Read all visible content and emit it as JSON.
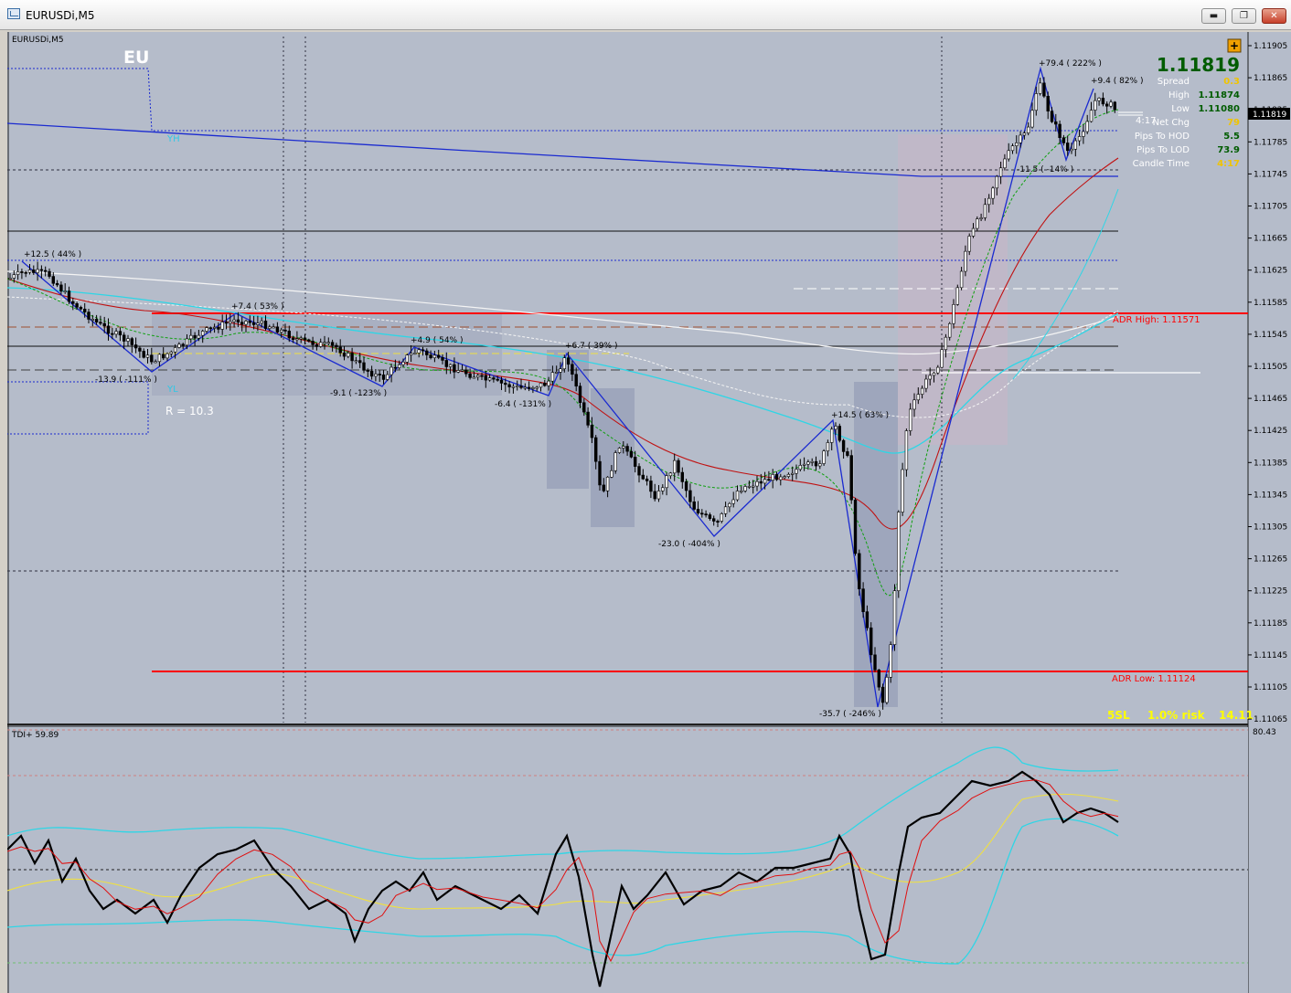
{
  "window": {
    "title": "EURUSDi,M5",
    "buttons": {
      "minimize": "▬",
      "maximize": "❐",
      "close": "✕"
    }
  },
  "chart": {
    "name": "EURUSDi,M5",
    "symbol_label": "EU",
    "yh_label": "YH",
    "yl_label": "YL",
    "range_label": "R = 10.3",
    "current_price": "1.11819",
    "price_tag": "1.11819",
    "countdown": "4:17",
    "price_axis": [
      "1.11905",
      "1.11865",
      "1.11825",
      "1.11785",
      "1.11745",
      "1.11705",
      "1.11665",
      "1.11625",
      "1.11585",
      "1.11545",
      "1.11505",
      "1.11465",
      "1.11425",
      "1.11385",
      "1.11345",
      "1.11305",
      "1.11265",
      "1.11225",
      "1.11185",
      "1.11145",
      "1.11105",
      "1.11065"
    ],
    "adr_high": "ADR High: 1.11571",
    "adr_low": "ADR Low: 1.11124",
    "zigzag_labels": [
      "+12.5 ( 44% )",
      "-13.9 ( -111% )",
      "+7.4 ( 53% )",
      "-9.1 ( -123% )",
      "+4.9 ( 54% )",
      "-6.4 ( -131% )",
      "+6.7 ( 39% )",
      "-23.0 ( -404% )",
      "+14.5 ( 63% )",
      "-35.7 ( -246% )",
      "+79.4 ( 222% )",
      "-11.5 ( -14% )",
      "+9.4 ( 82% )"
    ],
    "stats": [
      {
        "label": "Spread",
        "value": "0.3",
        "color": "#f0c400"
      },
      {
        "label": "High",
        "value": "1.11874",
        "color": "#005c00"
      },
      {
        "label": "Low",
        "value": "1.11080",
        "color": "#005c00"
      },
      {
        "label": "Net Chg",
        "value": "79",
        "color": "#f0c400"
      },
      {
        "label": "Pips To HOD",
        "value": "5.5",
        "color": "#005c00"
      },
      {
        "label": "Pips To LOD",
        "value": "73.9",
        "color": "#005c00"
      },
      {
        "label": "Candle Time",
        "value": "4:17",
        "color": "#f0c400"
      }
    ],
    "risk": {
      "sl": "5SL",
      "risk": "1.0% risk",
      "lots": "14.11"
    },
    "plus_button": "+"
  },
  "indicator": {
    "title": "TDI+ 59.89",
    "max_label": "80.43"
  },
  "colors": {
    "background": "#b5bcca",
    "candle": "#000000",
    "adr": "#ff0000",
    "zigzag": "#1020c0",
    "yellow_text": "#ffff00",
    "tdi_band": "#2ed6e6",
    "tdi_signal": "#e01010",
    "tdi_base": "#ffff00"
  }
}
